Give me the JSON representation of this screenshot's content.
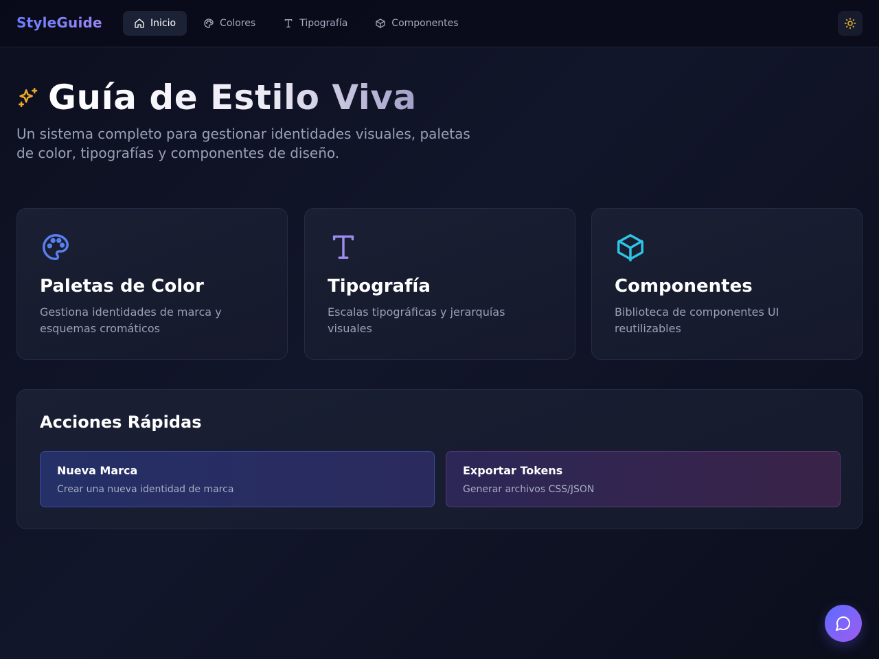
{
  "header": {
    "brand": "StyleGuide",
    "nav": [
      {
        "label": "Inicio",
        "icon": "home-icon",
        "active": true
      },
      {
        "label": "Colores",
        "icon": "palette-icon",
        "active": false
      },
      {
        "label": "Tipografía",
        "icon": "type-icon",
        "active": false
      },
      {
        "label": "Componentes",
        "icon": "box-icon",
        "active": false
      }
    ],
    "theme_toggle_icon": "sun-icon"
  },
  "hero": {
    "title": "Guía de Estilo Viva",
    "title_icon": "sparkles-icon",
    "subtitle": "Un sistema completo para gestionar identidades visuales, paletas de color, tipografías y componentes de diseño."
  },
  "cards": [
    {
      "title": "Paletas de Color",
      "description": "Gestiona identidades de marca y esquemas cromáticos",
      "icon": "palette-icon",
      "color": "#5b7ff0"
    },
    {
      "title": "Tipografía",
      "description": "Escalas tipográficas y jerarquías visuales",
      "icon": "type-icon",
      "color": "#a08cf0"
    },
    {
      "title": "Componentes",
      "description": "Biblioteca de componentes UI reutilizables",
      "icon": "box-icon",
      "color": "#2ec5e6"
    }
  ],
  "quick_actions": {
    "title": "Acciones Rápidas",
    "items": [
      {
        "title": "Nueva Marca",
        "subtitle": "Crear una nueva identidad de marca"
      },
      {
        "title": "Exportar Tokens",
        "subtitle": "Generar archivos CSS/JSON"
      }
    ]
  },
  "chat_button_icon": "chat-icon",
  "colors": {
    "accent": "#6a7dff",
    "sun": "#f5b82e",
    "sparkle": "#f0a82a"
  }
}
